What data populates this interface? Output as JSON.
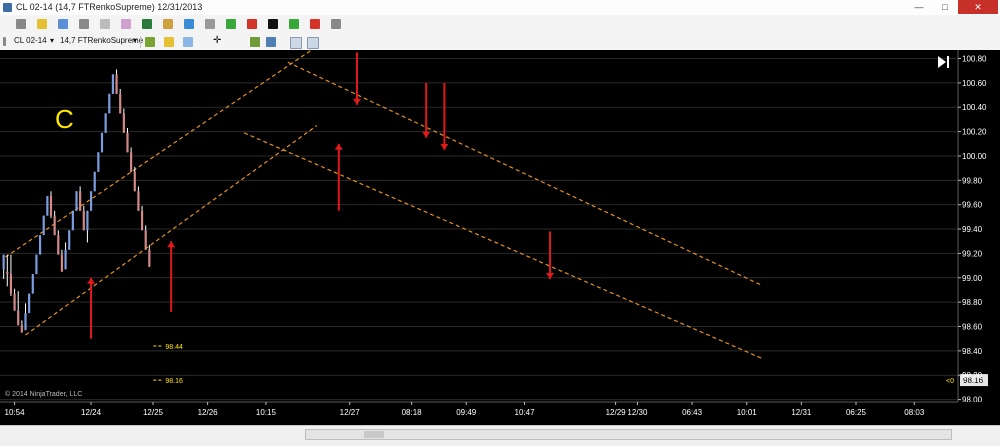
{
  "window": {
    "title": "CL 02-14 (14,7 FTRenkoSupreme)  12/31/2013",
    "minimize": "—",
    "maximize": "□",
    "close": "✕"
  },
  "toolbar": {
    "instrument": "CL 02-14",
    "instrument_arrow": "▾",
    "bar_type": "14,7 FTRenkoSupreme",
    "bar_type_arrow": "▾",
    "icons": [
      "layout-icon",
      "yellow-square-icon",
      "color-square-icon",
      "color-square-icon",
      "color-square-icon",
      "color-square-icon",
      "color-square-icon",
      "color-square-icon",
      "color-square-icon",
      "color-square-icon",
      "green-up-arrow-icon",
      "red-down-arrow-icon",
      "black-circle-icon",
      "green-up-arrow-icon",
      "red-down-arrow-icon",
      "gray-square-icon",
      "pencil-icon",
      "bar-style-icon",
      "pencil-color-icon",
      "crosshair-icon",
      "properties-icon",
      "template-icon",
      "window-icon",
      "data-box-icon"
    ]
  },
  "colors": {
    "background": "#000000",
    "up_bar": "#7b9de0",
    "down_bar": "#d58888",
    "wick": "#ffffff",
    "channel": "#e39020",
    "arrow": "#e0191a",
    "label": "#ffe400",
    "price_tag_bg": "#e6e6e6"
  },
  "chart_data": {
    "type": "candlestick",
    "annotation": "C",
    "copyright": "© 2014 NinjaTrader, LLC",
    "x_tick_labels": [
      "10:54",
      "12/24",
      "12/25",
      "12/26",
      "10:15",
      "12/27",
      "08:18",
      "09:49",
      "10:47",
      "12/29",
      "12/30",
      "06:43",
      "10:01",
      "12/31",
      "06:25",
      "08:03"
    ],
    "x_tick_positions": [
      3,
      24,
      41,
      56,
      72,
      95,
      112,
      127,
      143,
      168,
      174,
      189,
      204,
      219,
      234,
      250
    ],
    "y_ticks": [
      98.0,
      98.2,
      98.4,
      98.6,
      98.8,
      99.0,
      99.2,
      99.4,
      99.6,
      99.8,
      100.0,
      100.2,
      100.4,
      100.6,
      100.8
    ],
    "y_tick_labels": [
      "98.00",
      "98.20",
      "98.40",
      "98.60",
      "98.80",
      "99.00",
      "99.20",
      "99.40",
      "99.60",
      "99.80",
      "100.00",
      "100.20",
      "100.40",
      "100.60",
      "100.80"
    ],
    "ylim": [
      97.98,
      100.87
    ],
    "xlim": [
      -1,
      262
    ],
    "last_price": "98.16",
    "price_marker": "<0",
    "level_labels": [
      {
        "price": 98.44,
        "label": "98.44"
      },
      {
        "price": 98.16,
        "label": "98.16"
      }
    ],
    "bars": [
      [
        0,
        99.07,
        99.19,
        98.99,
        99.19
      ],
      [
        1,
        99.05,
        99.19,
        98.93,
        99.03
      ],
      [
        2,
        99.03,
        99.19,
        98.85,
        98.87
      ],
      [
        3,
        98.87,
        98.91,
        98.73,
        98.73
      ],
      [
        4,
        98.73,
        98.89,
        98.61,
        98.61
      ],
      [
        5,
        98.61,
        98.65,
        98.55,
        98.55
      ],
      [
        6,
        98.57,
        98.79,
        98.57,
        98.71
      ],
      [
        7,
        98.71,
        98.87,
        98.71,
        98.87
      ],
      [
        8,
        98.87,
        99.03,
        98.87,
        99.03
      ],
      [
        9,
        99.03,
        99.19,
        99.03,
        99.19
      ],
      [
        10,
        99.19,
        99.35,
        99.19,
        99.35
      ],
      [
        11,
        99.35,
        99.51,
        99.35,
        99.51
      ],
      [
        12,
        99.51,
        99.67,
        99.51,
        99.67
      ],
      [
        13,
        99.67,
        99.71,
        99.49,
        99.51
      ],
      [
        14,
        99.51,
        99.55,
        99.35,
        99.35
      ],
      [
        15,
        99.35,
        99.39,
        99.19,
        99.19
      ],
      [
        16,
        99.19,
        99.23,
        99.05,
        99.05
      ],
      [
        17,
        99.07,
        99.29,
        99.07,
        99.23
      ],
      [
        18,
        99.23,
        99.39,
        99.23,
        99.39
      ],
      [
        19,
        99.39,
        99.55,
        99.39,
        99.55
      ],
      [
        20,
        99.55,
        99.71,
        99.55,
        99.71
      ],
      [
        21,
        99.71,
        99.75,
        99.55,
        99.55
      ],
      [
        22,
        99.55,
        99.59,
        99.39,
        99.39
      ],
      [
        23,
        99.39,
        99.55,
        99.29,
        99.55
      ],
      [
        24,
        99.55,
        99.71,
        99.55,
        99.71
      ],
      [
        25,
        99.71,
        99.87,
        99.71,
        99.87
      ],
      [
        26,
        99.87,
        100.03,
        99.87,
        100.03
      ],
      [
        27,
        100.03,
        100.19,
        100.03,
        100.19
      ],
      [
        28,
        100.19,
        100.35,
        100.19,
        100.35
      ],
      [
        29,
        100.35,
        100.51,
        100.35,
        100.51
      ],
      [
        30,
        100.51,
        100.67,
        100.51,
        100.67
      ],
      [
        31,
        100.67,
        100.71,
        100.51,
        100.51
      ],
      [
        32,
        100.51,
        100.55,
        100.35,
        100.35
      ],
      [
        33,
        100.35,
        100.39,
        100.19,
        100.19
      ],
      [
        34,
        100.19,
        100.23,
        100.03,
        100.03
      ],
      [
        35,
        100.03,
        100.07,
        99.87,
        99.87
      ],
      [
        36,
        99.87,
        99.91,
        99.71,
        99.71
      ],
      [
        37,
        99.71,
        99.75,
        99.55,
        99.55
      ],
      [
        38,
        99.55,
        99.59,
        99.39,
        99.39
      ],
      [
        39,
        99.39,
        99.43,
        99.23,
        99.23
      ],
      [
        40,
        99.23,
        99.27,
        99.09,
        99.09
      ]
    ],
    "channels": [
      {
        "x1": 0.5,
        "y1": 99.17,
        "x2": 87,
        "y2": 100.92
      },
      {
        "x1": 6,
        "y1": 98.53,
        "x2": 86,
        "y2": 100.25
      },
      {
        "x1": 78,
        "y1": 100.77,
        "x2": 208,
        "y2": 98.94
      },
      {
        "x1": 66,
        "y1": 100.19,
        "x2": 208,
        "y2": 98.34
      }
    ],
    "arrows": [
      {
        "x": 24,
        "y_from": 98.5,
        "y_to": 99.0,
        "direction": "up"
      },
      {
        "x": 46,
        "y_from": 98.72,
        "y_to": 99.3,
        "direction": "up"
      },
      {
        "x": 92,
        "y_from": 99.55,
        "y_to": 100.1,
        "direction": "up"
      },
      {
        "x": 97,
        "y_from": 100.85,
        "y_to": 100.42,
        "direction": "down"
      },
      {
        "x": 116,
        "y_from": 100.6,
        "y_to": 100.15,
        "direction": "down"
      },
      {
        "x": 121,
        "y_from": 100.6,
        "y_to": 100.05,
        "direction": "down"
      },
      {
        "x": 150,
        "y_from": 99.38,
        "y_to": 98.99,
        "direction": "down"
      }
    ]
  }
}
